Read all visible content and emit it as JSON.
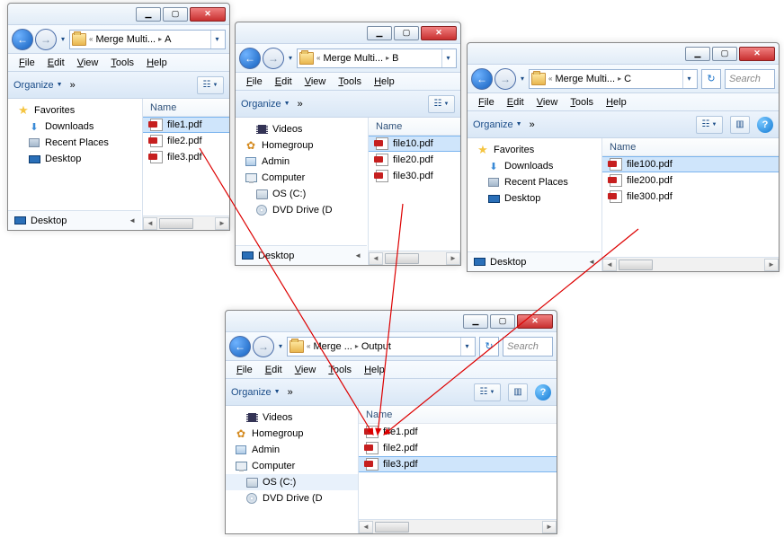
{
  "menu": {
    "file": "File",
    "edit": "Edit",
    "view": "View",
    "tools": "Tools",
    "help": "Help"
  },
  "toolbar": {
    "organize": "Organize",
    "chev": "»"
  },
  "col": {
    "name": "Name"
  },
  "search": "Search",
  "winA": {
    "crumb1": "Merge Multi...",
    "crumb2": "A",
    "favorites": "Favorites",
    "downloads": "Downloads",
    "recent": "Recent Places",
    "desktop": "Desktop",
    "foot": "Desktop",
    "files": {
      "f1": "file1.pdf",
      "f2": "file2.pdf",
      "f3": "file3.pdf"
    }
  },
  "winB": {
    "crumb1": "Merge Multi...",
    "crumb2": "B",
    "videos": "Videos",
    "homegroup": "Homegroup",
    "admin": "Admin",
    "computer": "Computer",
    "os": "OS (C:)",
    "dvd": "DVD Drive (D",
    "foot": "Desktop",
    "files": {
      "f1": "file10.pdf",
      "f2": "file20.pdf",
      "f3": "file30.pdf"
    }
  },
  "winC": {
    "crumb1": "Merge Multi...",
    "crumb2": "C",
    "favorites": "Favorites",
    "downloads": "Downloads",
    "recent": "Recent Places",
    "desktop": "Desktop",
    "foot": "Desktop",
    "files": {
      "f1": "file100.pdf",
      "f2": "file200.pdf",
      "f3": "file300.pdf"
    }
  },
  "winOut": {
    "crumb1": "Merge ...",
    "crumb2": "Output",
    "videos": "Videos",
    "homegroup": "Homegroup",
    "admin": "Admin",
    "computer": "Computer",
    "os": "OS (C:)",
    "dvd": "DVD Drive (D",
    "files": {
      "f1": "file1.pdf",
      "f2": "file2.pdf",
      "f3": "file3.pdf"
    }
  }
}
